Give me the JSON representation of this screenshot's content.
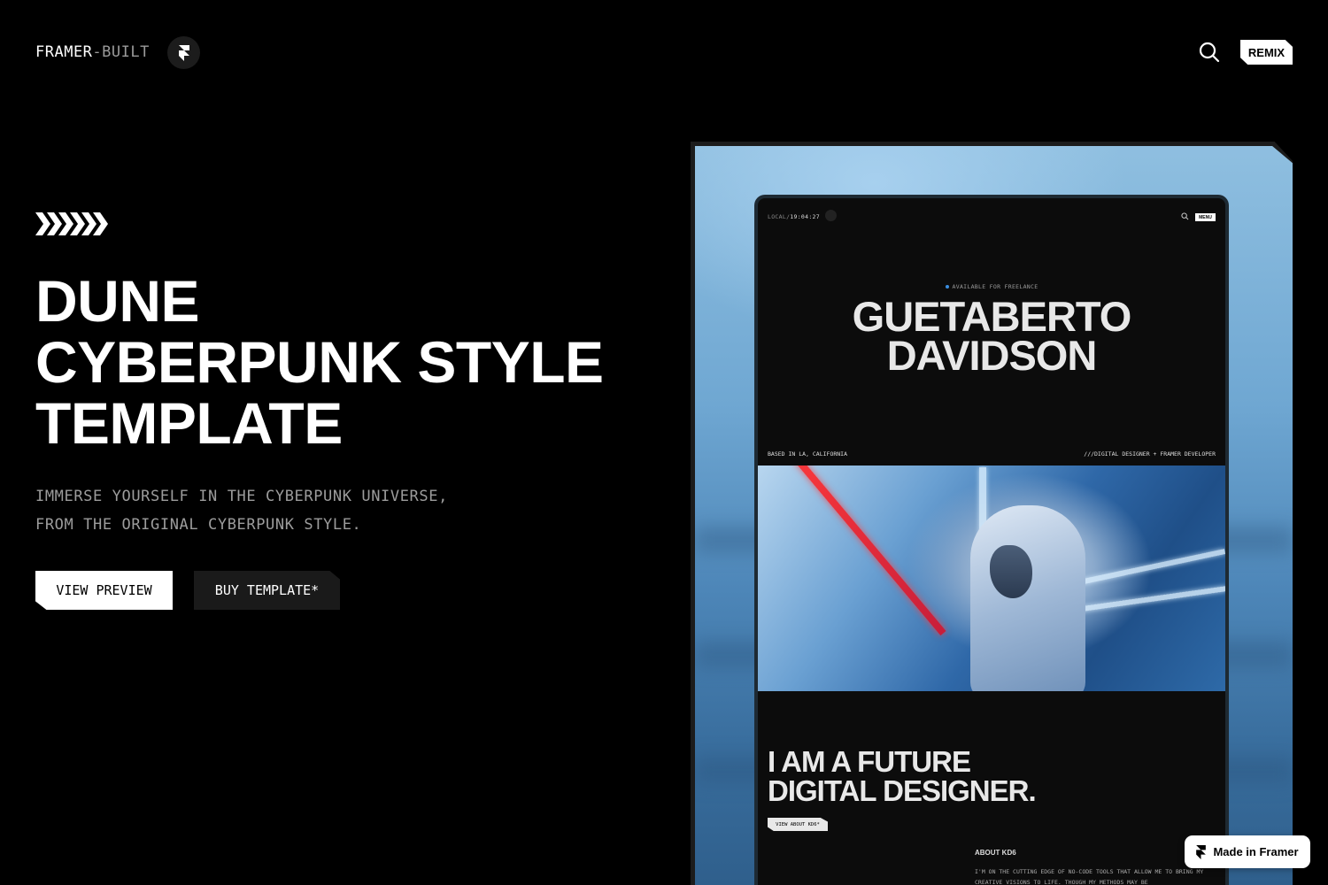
{
  "header": {
    "brand_main": "FRAMER",
    "brand_suffix": "-BUILT",
    "remix_label": "REMIX"
  },
  "hero": {
    "title_lines": [
      "DUNE",
      "CYBERPUNK STYLE",
      "TEMPLATE"
    ],
    "subtitle_lines": [
      "IMMERSE YOURSELF IN THE CYBERPUNK UNIVERSE,",
      "FROM THE ORIGINAL CYBERPUNK STYLE."
    ],
    "primary_button": "VIEW PREVIEW",
    "secondary_button": "BUY TEMPLATE*"
  },
  "preview": {
    "local_prefix": "LOCAL/",
    "local_time": "19:04:27",
    "menu_label": "MENU",
    "availability": "AVAILABLE FOR FREELANCE",
    "name_lines": [
      "GUETABERTO",
      "DAVIDSON"
    ],
    "based_in": "BASED IN LA, CALIFORNIA",
    "role": "///DIGITAL DESIGNER + FRAMER DEVELOPER",
    "statement_lines": [
      "I AM A FUTURE",
      "DIGITAL DESIGNER."
    ],
    "about_button": "VIEW ABOUT KD6*",
    "about_title": "ABOUT KD6",
    "about_text": "I'M ON THE CUTTING EDGE OF NO-CODE TOOLS THAT ALLOW ME TO BRING MY CREATIVE VISIONS TO LIFE. THOUGH MY METHODS MAY BE"
  },
  "badge": {
    "label": "Made in Framer"
  },
  "colors": {
    "background": "#000000",
    "accent_blue": "#3a8de0",
    "accent_red": "#ff3b3b"
  },
  "icons": [
    "framer-logo-icon",
    "search-icon",
    "chevrons-icon",
    "phone-icon"
  ]
}
